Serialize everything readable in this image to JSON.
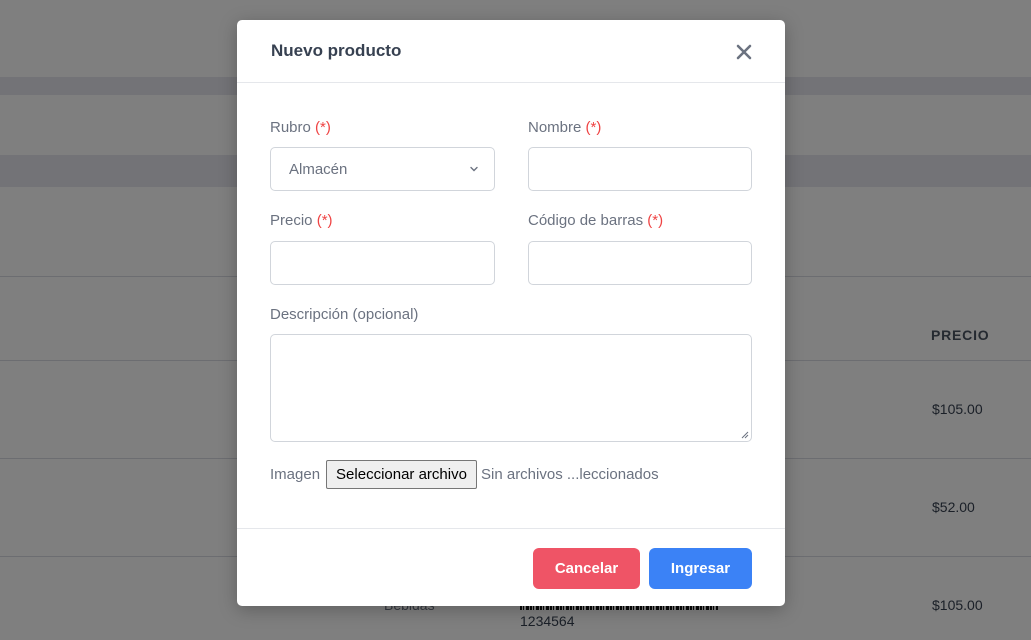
{
  "background": {
    "table_header_price": "PRECIO",
    "prices": [
      "$105.00",
      "$52.00",
      "$105.00"
    ],
    "row_category": "Bebidas",
    "barcode_number": "1234564"
  },
  "modal": {
    "title": "Nuevo producto",
    "close_icon": "close-icon",
    "fields": {
      "rubro": {
        "label": "Rubro",
        "required_mark": "(*)",
        "value": "Almacén"
      },
      "nombre": {
        "label": "Nombre",
        "required_mark": "(*)",
        "value": ""
      },
      "precio": {
        "label": "Precio",
        "required_mark": "(*)",
        "value": ""
      },
      "codigo": {
        "label": "Código de barras",
        "required_mark": "(*)",
        "value": ""
      },
      "descripcion": {
        "label": "Descripción (opcional)",
        "value": ""
      },
      "imagen": {
        "label": "Imagen",
        "button_label": "Seleccionar archivo",
        "status": "Sin archivos ...leccionados"
      }
    },
    "buttons": {
      "cancel": "Cancelar",
      "submit": "Ingresar"
    }
  },
  "colors": {
    "danger": "#ef5466",
    "primary": "#3b82f6",
    "required": "#ef4444"
  }
}
